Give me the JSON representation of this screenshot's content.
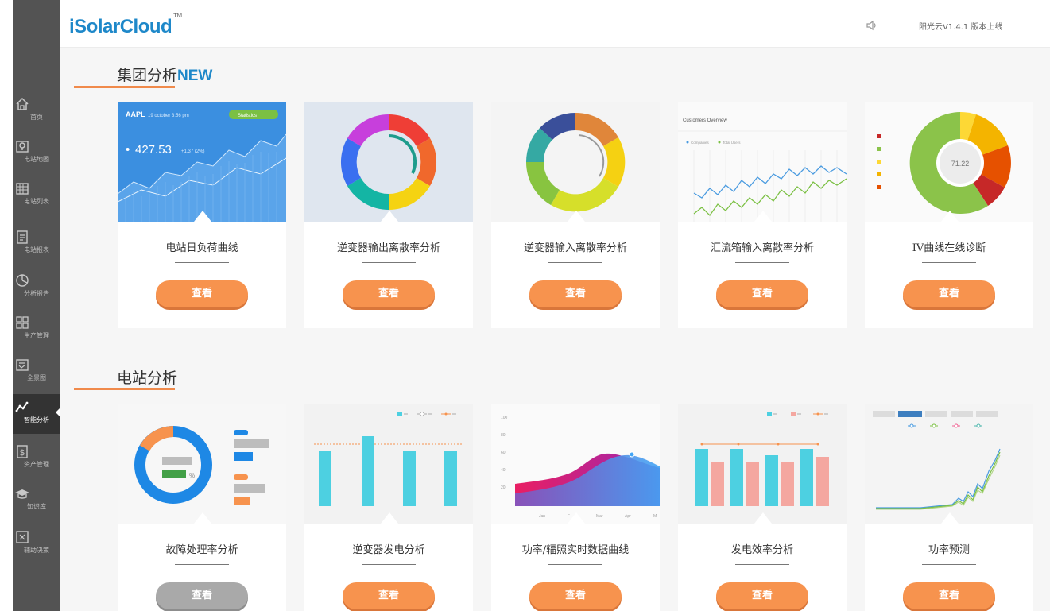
{
  "app": {
    "logo": "iSolarCloud",
    "tm": "TM",
    "version": "阳光云V1.4.1 版本上线"
  },
  "sidebar": {
    "items": [
      {
        "label": "首页",
        "icon": "home-icon"
      },
      {
        "label": "电站地图",
        "icon": "map-pin-icon"
      },
      {
        "label": "电站列表",
        "icon": "grid-list-icon"
      },
      {
        "label": "电站报表",
        "icon": "report-icon"
      },
      {
        "label": "分析报告",
        "icon": "pie-icon"
      },
      {
        "label": "生产管理",
        "icon": "squares-icon"
      },
      {
        "label": "全景图",
        "icon": "panorama-icon"
      },
      {
        "label": "智能分析",
        "icon": "trend-icon",
        "active": true
      },
      {
        "label": "资产管理",
        "icon": "dollar-icon"
      },
      {
        "label": "知识库",
        "icon": "graduation-cap-icon"
      },
      {
        "label": "辅助决策",
        "icon": "decision-icon"
      }
    ]
  },
  "sections": [
    {
      "title": "集团分析",
      "badge": "NEW",
      "cards": [
        {
          "name": "电站日负荷曲线",
          "button": "查看",
          "thumb": "stock-chart",
          "stock": {
            "ticker": "AAPL",
            "date": "19 october 3:56 pm",
            "tag": "Statistics",
            "value": "427.53",
            "change": "+1.37 (2%)"
          }
        },
        {
          "name": "逆变器输出离散率分析",
          "button": "查看",
          "thumb": "donut-multicolor"
        },
        {
          "name": "逆变器输入离散率分析",
          "button": "查看",
          "thumb": "donut-warm"
        },
        {
          "name": "汇流箱输入离散率分析",
          "button": "查看",
          "thumb": "line-overview",
          "overview": {
            "title": "Customers Overview",
            "legend1": "Companies",
            "legend2": "Total Users"
          }
        },
        {
          "name": "IV曲线在线诊断",
          "button": "查看",
          "thumb": "pie-gauge",
          "gauge": {
            "value": "71.22"
          }
        }
      ]
    },
    {
      "title": "电站分析",
      "badge": "",
      "cards": [
        {
          "name": "故障处理率分析",
          "button": "查看",
          "button_disabled": true,
          "thumb": "donut-percent",
          "percent_sign": "%"
        },
        {
          "name": "逆变器发电分析",
          "button": "查看",
          "thumb": "bars-cyan"
        },
        {
          "name": "功率/辐照实时数据曲线",
          "button": "查看",
          "thumb": "area-chart",
          "area": {
            "yticks": [
              "100",
              "80",
              "60",
              "40",
              "20"
            ],
            "xticks": [
              "Jan",
              "F",
              "Mar",
              "Apr",
              "M"
            ]
          }
        },
        {
          "name": "发电效率分析",
          "button": "查看",
          "thumb": "bars-pair"
        },
        {
          "name": "功率预测",
          "button": "查看",
          "thumb": "line-forecast"
        }
      ]
    }
  ],
  "colors": {
    "accent": "#f7934e",
    "brand": "#1e88c9",
    "sidebar": "#535353"
  }
}
